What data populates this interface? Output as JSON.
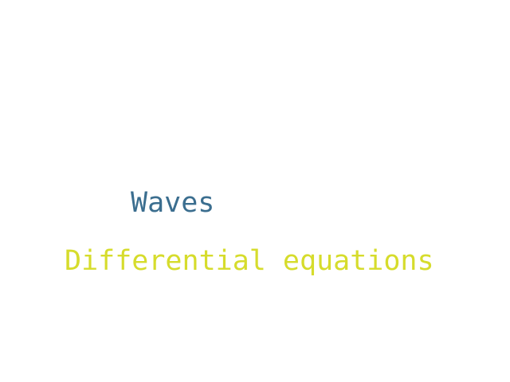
{
  "words": [
    {
      "text": "Waves",
      "color": "#3b6e8f"
    },
    {
      "text": "Differential equations",
      "color": "#d6dc2c"
    }
  ]
}
